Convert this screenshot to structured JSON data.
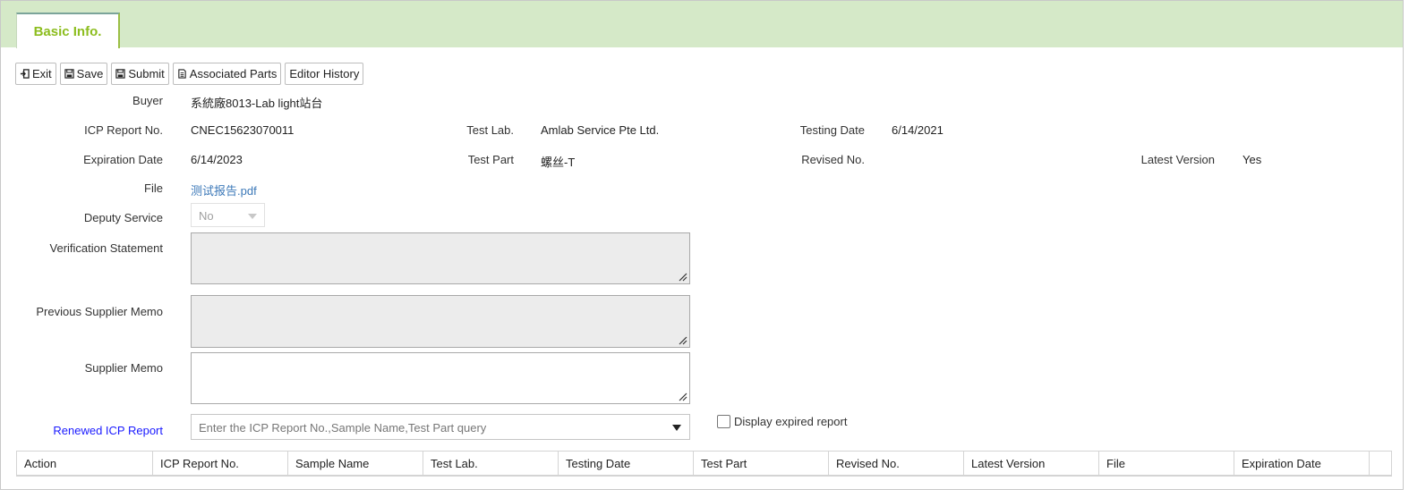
{
  "tabs": [
    {
      "label": "Basic Info."
    }
  ],
  "toolbar": {
    "exit": "Exit",
    "save": "Save",
    "submit": "Submit",
    "associated_parts": "Associated Parts",
    "editor_history": "Editor History"
  },
  "form": {
    "buyer_label": "Buyer",
    "buyer_value": "系統廠8013-Lab light站台",
    "icp_label": "ICP Report No.",
    "icp_value": "CNEC15623070011",
    "test_lab_label": "Test Lab.",
    "test_lab_value": "Amlab Service Pte Ltd.",
    "testing_date_label": "Testing Date",
    "testing_date_value": "6/14/2021",
    "expiration_label": "Expiration Date",
    "expiration_value": "6/14/2023",
    "test_part_label": "Test Part",
    "test_part_value": "螺丝-T",
    "revised_label": "Revised No.",
    "revised_value": "",
    "latest_label": "Latest Version",
    "latest_value": "Yes",
    "file_label": "File",
    "file_value": "测试报告.pdf",
    "deputy_label": "Deputy Service",
    "deputy_value": "No",
    "verification_label": "Verification Statement",
    "prev_memo_label": "Previous Supplier Memo",
    "supplier_memo_label": "Supplier Memo",
    "renewed_label": "Renewed ICP Report",
    "renewed_placeholder": "Enter the ICP Report No.,Sample Name,Test Part query",
    "display_expired_label": "Display expired report"
  },
  "table": {
    "columns": [
      "Action",
      "ICP Report No.",
      "Sample Name",
      "Test Lab.",
      "Testing Date",
      "Test Part",
      "Revised No.",
      "Latest Version",
      "File",
      "Expiration Date"
    ]
  },
  "colors": {
    "tabbar_bg": "#d5e9c8",
    "tab_text": "#8cbd1e",
    "link": "#3b78b8",
    "renewed_label": "#1a1aff"
  }
}
